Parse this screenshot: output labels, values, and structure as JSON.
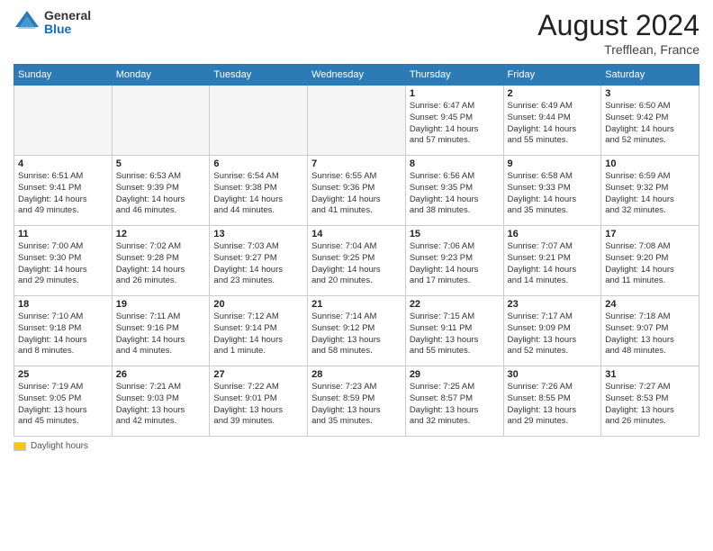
{
  "header": {
    "logo": {
      "general": "General",
      "blue": "Blue"
    },
    "month_year": "August 2024",
    "location": "Trefflean, France"
  },
  "days_of_week": [
    "Sunday",
    "Monday",
    "Tuesday",
    "Wednesday",
    "Thursday",
    "Friday",
    "Saturday"
  ],
  "weeks": [
    [
      {
        "day": null,
        "info": null
      },
      {
        "day": null,
        "info": null
      },
      {
        "day": null,
        "info": null
      },
      {
        "day": null,
        "info": null
      },
      {
        "day": "1",
        "info": "Sunrise: 6:47 AM\nSunset: 9:45 PM\nDaylight: 14 hours\nand 57 minutes."
      },
      {
        "day": "2",
        "info": "Sunrise: 6:49 AM\nSunset: 9:44 PM\nDaylight: 14 hours\nand 55 minutes."
      },
      {
        "day": "3",
        "info": "Sunrise: 6:50 AM\nSunset: 9:42 PM\nDaylight: 14 hours\nand 52 minutes."
      }
    ],
    [
      {
        "day": "4",
        "info": "Sunrise: 6:51 AM\nSunset: 9:41 PM\nDaylight: 14 hours\nand 49 minutes."
      },
      {
        "day": "5",
        "info": "Sunrise: 6:53 AM\nSunset: 9:39 PM\nDaylight: 14 hours\nand 46 minutes."
      },
      {
        "day": "6",
        "info": "Sunrise: 6:54 AM\nSunset: 9:38 PM\nDaylight: 14 hours\nand 44 minutes."
      },
      {
        "day": "7",
        "info": "Sunrise: 6:55 AM\nSunset: 9:36 PM\nDaylight: 14 hours\nand 41 minutes."
      },
      {
        "day": "8",
        "info": "Sunrise: 6:56 AM\nSunset: 9:35 PM\nDaylight: 14 hours\nand 38 minutes."
      },
      {
        "day": "9",
        "info": "Sunrise: 6:58 AM\nSunset: 9:33 PM\nDaylight: 14 hours\nand 35 minutes."
      },
      {
        "day": "10",
        "info": "Sunrise: 6:59 AM\nSunset: 9:32 PM\nDaylight: 14 hours\nand 32 minutes."
      }
    ],
    [
      {
        "day": "11",
        "info": "Sunrise: 7:00 AM\nSunset: 9:30 PM\nDaylight: 14 hours\nand 29 minutes."
      },
      {
        "day": "12",
        "info": "Sunrise: 7:02 AM\nSunset: 9:28 PM\nDaylight: 14 hours\nand 26 minutes."
      },
      {
        "day": "13",
        "info": "Sunrise: 7:03 AM\nSunset: 9:27 PM\nDaylight: 14 hours\nand 23 minutes."
      },
      {
        "day": "14",
        "info": "Sunrise: 7:04 AM\nSunset: 9:25 PM\nDaylight: 14 hours\nand 20 minutes."
      },
      {
        "day": "15",
        "info": "Sunrise: 7:06 AM\nSunset: 9:23 PM\nDaylight: 14 hours\nand 17 minutes."
      },
      {
        "day": "16",
        "info": "Sunrise: 7:07 AM\nSunset: 9:21 PM\nDaylight: 14 hours\nand 14 minutes."
      },
      {
        "day": "17",
        "info": "Sunrise: 7:08 AM\nSunset: 9:20 PM\nDaylight: 14 hours\nand 11 minutes."
      }
    ],
    [
      {
        "day": "18",
        "info": "Sunrise: 7:10 AM\nSunset: 9:18 PM\nDaylight: 14 hours\nand 8 minutes."
      },
      {
        "day": "19",
        "info": "Sunrise: 7:11 AM\nSunset: 9:16 PM\nDaylight: 14 hours\nand 4 minutes."
      },
      {
        "day": "20",
        "info": "Sunrise: 7:12 AM\nSunset: 9:14 PM\nDaylight: 14 hours\nand 1 minute."
      },
      {
        "day": "21",
        "info": "Sunrise: 7:14 AM\nSunset: 9:12 PM\nDaylight: 13 hours\nand 58 minutes."
      },
      {
        "day": "22",
        "info": "Sunrise: 7:15 AM\nSunset: 9:11 PM\nDaylight: 13 hours\nand 55 minutes."
      },
      {
        "day": "23",
        "info": "Sunrise: 7:17 AM\nSunset: 9:09 PM\nDaylight: 13 hours\nand 52 minutes."
      },
      {
        "day": "24",
        "info": "Sunrise: 7:18 AM\nSunset: 9:07 PM\nDaylight: 13 hours\nand 48 minutes."
      }
    ],
    [
      {
        "day": "25",
        "info": "Sunrise: 7:19 AM\nSunset: 9:05 PM\nDaylight: 13 hours\nand 45 minutes."
      },
      {
        "day": "26",
        "info": "Sunrise: 7:21 AM\nSunset: 9:03 PM\nDaylight: 13 hours\nand 42 minutes."
      },
      {
        "day": "27",
        "info": "Sunrise: 7:22 AM\nSunset: 9:01 PM\nDaylight: 13 hours\nand 39 minutes."
      },
      {
        "day": "28",
        "info": "Sunrise: 7:23 AM\nSunset: 8:59 PM\nDaylight: 13 hours\nand 35 minutes."
      },
      {
        "day": "29",
        "info": "Sunrise: 7:25 AM\nSunset: 8:57 PM\nDaylight: 13 hours\nand 32 minutes."
      },
      {
        "day": "30",
        "info": "Sunrise: 7:26 AM\nSunset: 8:55 PM\nDaylight: 13 hours\nand 29 minutes."
      },
      {
        "day": "31",
        "info": "Sunrise: 7:27 AM\nSunset: 8:53 PM\nDaylight: 13 hours\nand 26 minutes."
      }
    ]
  ],
  "footer": {
    "legend_label": "Daylight hours"
  }
}
